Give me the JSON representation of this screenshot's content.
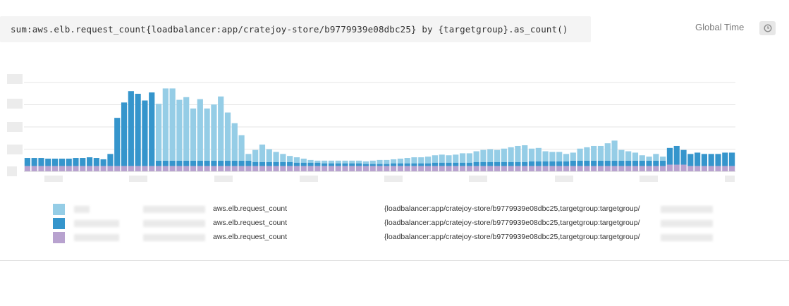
{
  "query": {
    "text": "sum:aws.elb.request_count{loadbalancer:app/cratejoy-store/b9779939e08dbc25} by {targetgroup}.as_count()"
  },
  "header": {
    "global_time_label": "Global Time",
    "time_button_icon": "clock-icon"
  },
  "colors": {
    "series_light_blue": "#95cde6",
    "series_dark_blue": "#3595cc",
    "series_purple": "#b8a2cf",
    "gridline": "#e6e6e6"
  },
  "chart_data": {
    "type": "bar",
    "stacked": true,
    "y_axis_labels_redacted": true,
    "x_axis_labels_redacted": true,
    "series": [
      {
        "color": "#b8a2cf",
        "values": [
          8,
          8,
          8,
          8,
          8,
          8,
          8,
          8,
          8,
          8,
          8,
          8,
          8,
          8,
          8,
          8,
          8,
          8,
          8,
          8,
          8,
          8,
          8,
          8,
          8,
          8,
          8,
          8,
          8,
          8,
          8,
          8,
          8,
          8,
          8,
          8,
          8,
          8,
          8,
          8,
          8,
          8,
          8,
          8,
          8,
          8,
          8,
          8,
          8,
          8,
          8,
          8,
          8,
          8,
          8,
          8,
          8,
          8,
          8,
          8,
          8,
          8,
          8,
          8,
          8,
          8,
          8,
          8,
          8,
          8,
          8,
          8,
          8,
          8,
          8,
          8,
          8,
          8,
          8,
          8,
          8,
          8,
          8,
          8,
          8,
          8,
          8,
          8,
          8,
          8,
          8,
          8,
          8,
          10,
          10,
          10,
          8,
          8,
          8,
          8,
          8,
          8,
          8
        ]
      },
      {
        "color": "#3595cc",
        "values": [
          12,
          12,
          12,
          11,
          11,
          11,
          11,
          12,
          12,
          13,
          12,
          10,
          18,
          72,
          95,
          112,
          108,
          98,
          110,
          8,
          8,
          8,
          8,
          8,
          8,
          8,
          8,
          8,
          8,
          8,
          8,
          8,
          8,
          6,
          6,
          6,
          6,
          6,
          6,
          5,
          5,
          5,
          5,
          4,
          4,
          4,
          4,
          4,
          4,
          3,
          3,
          3,
          3,
          4,
          4,
          4,
          4,
          4,
          4,
          5,
          5,
          5,
          5,
          5,
          5,
          6,
          6,
          6,
          6,
          6,
          6,
          6,
          6,
          7,
          7,
          7,
          7,
          7,
          7,
          8,
          8,
          8,
          8,
          8,
          8,
          8,
          8,
          8,
          8,
          8,
          8,
          8,
          8,
          25,
          28,
          22,
          18,
          20,
          18,
          18,
          18,
          20,
          20
        ]
      },
      {
        "color": "#95cde6",
        "values": [
          0,
          0,
          0,
          0,
          0,
          0,
          0,
          0,
          0,
          0,
          0,
          0,
          0,
          0,
          0,
          0,
          0,
          0,
          0,
          85,
          108,
          108,
          91,
          95,
          78,
          92,
          78,
          84,
          96,
          72,
          56,
          38,
          10,
          18,
          26,
          19,
          15,
          12,
          9,
          8,
          6,
          4,
          3,
          4,
          4,
          4,
          4,
          4,
          4,
          4,
          5,
          6,
          6,
          6,
          7,
          8,
          9,
          9,
          10,
          11,
          12,
          11,
          12,
          14,
          14,
          16,
          18,
          19,
          18,
          20,
          22,
          24,
          25,
          19,
          20,
          15,
          14,
          14,
          11,
          12,
          18,
          20,
          22,
          22,
          26,
          30,
          16,
          14,
          12,
          8,
          6,
          10,
          6,
          0,
          0,
          0,
          0,
          0,
          0,
          0,
          0,
          0,
          0
        ]
      }
    ]
  },
  "legend": {
    "rows": [
      {
        "swatch_color": "#95cde6",
        "metric": "aws.elb.request_count",
        "scope": "{loadbalancer:app/cratejoy-store/b9779939e08dbc25,targetgroup:targetgroup/"
      },
      {
        "swatch_color": "#3595cc",
        "metric": "aws.elb.request_count",
        "scope": "{loadbalancer:app/cratejoy-store/b9779939e08dbc25,targetgroup:targetgroup/"
      },
      {
        "swatch_color": "#b8a2cf",
        "metric": "aws.elb.request_count",
        "scope": "{loadbalancer:app/cratejoy-store/b9779939e08dbc25,targetgroup:targetgroup/"
      }
    ]
  }
}
